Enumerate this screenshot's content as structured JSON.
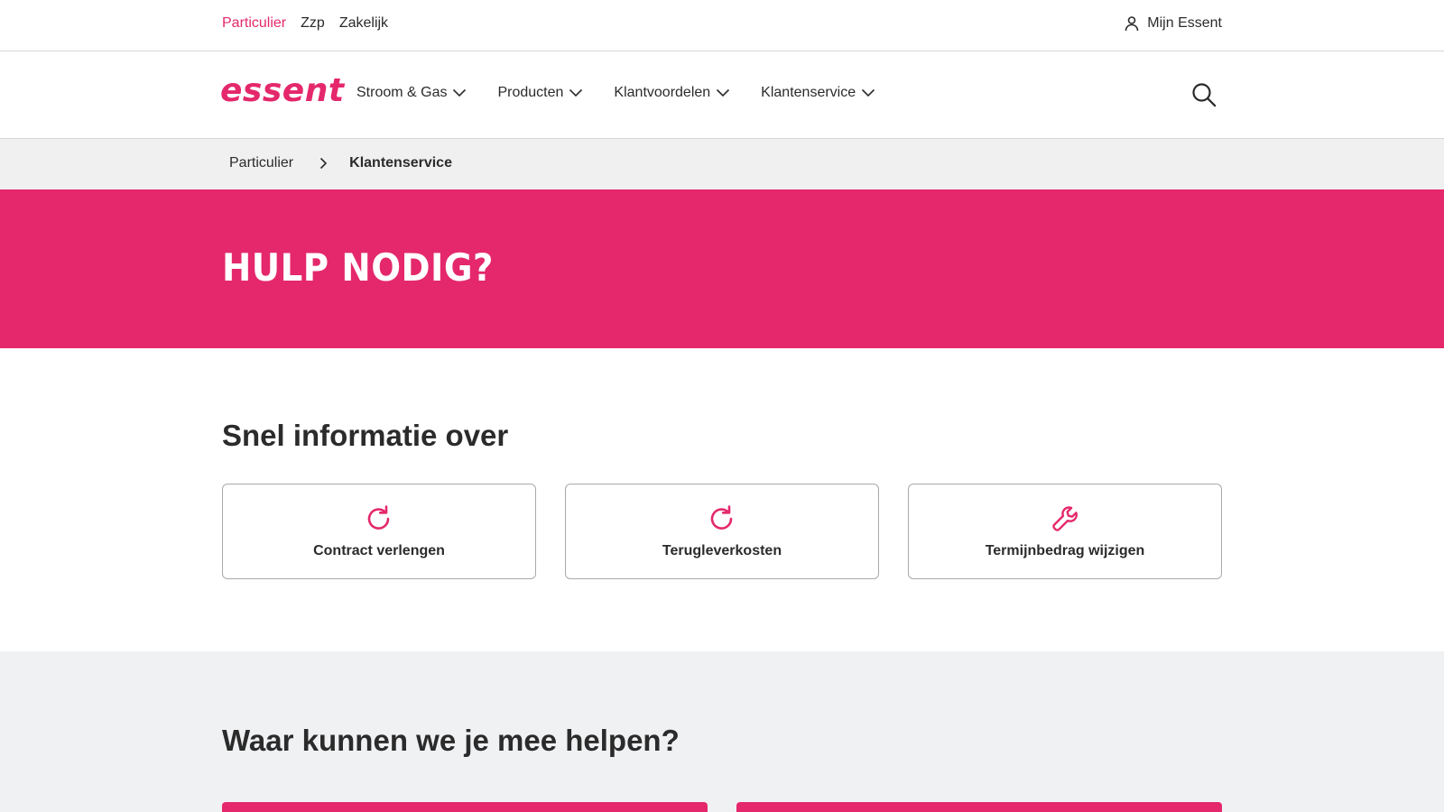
{
  "topbar": {
    "segments": [
      {
        "label": "Particulier",
        "active": true
      },
      {
        "label": "Zzp",
        "active": false
      },
      {
        "label": "Zakelijk",
        "active": false
      }
    ],
    "account_label": "Mijn Essent",
    "account_icon": "user-icon"
  },
  "nav": {
    "logo": "essent",
    "items": [
      {
        "label": "Stroom & Gas"
      },
      {
        "label": "Producten"
      },
      {
        "label": "Klantvoordelen"
      },
      {
        "label": "Klantenservice"
      }
    ],
    "search_icon": "search-icon"
  },
  "breadcrumb": {
    "items": [
      "Particulier",
      "Klantenservice"
    ]
  },
  "hero": {
    "title": "HULP NODIG?"
  },
  "quick": {
    "title": "Snel informatie over",
    "cards": [
      {
        "label": "Contract verlengen",
        "icon": "refresh-icon"
      },
      {
        "label": "Terugleverkosten",
        "icon": "refresh-icon"
      },
      {
        "label": "Termijnbedrag wijzigen",
        "icon": "wrench-icon"
      }
    ]
  },
  "help": {
    "title": "Waar kunnen we je mee helpen?"
  },
  "colors": {
    "brand": "#e4286b",
    "text": "#2b2b2b",
    "light_bg": "#f0f0f0"
  }
}
